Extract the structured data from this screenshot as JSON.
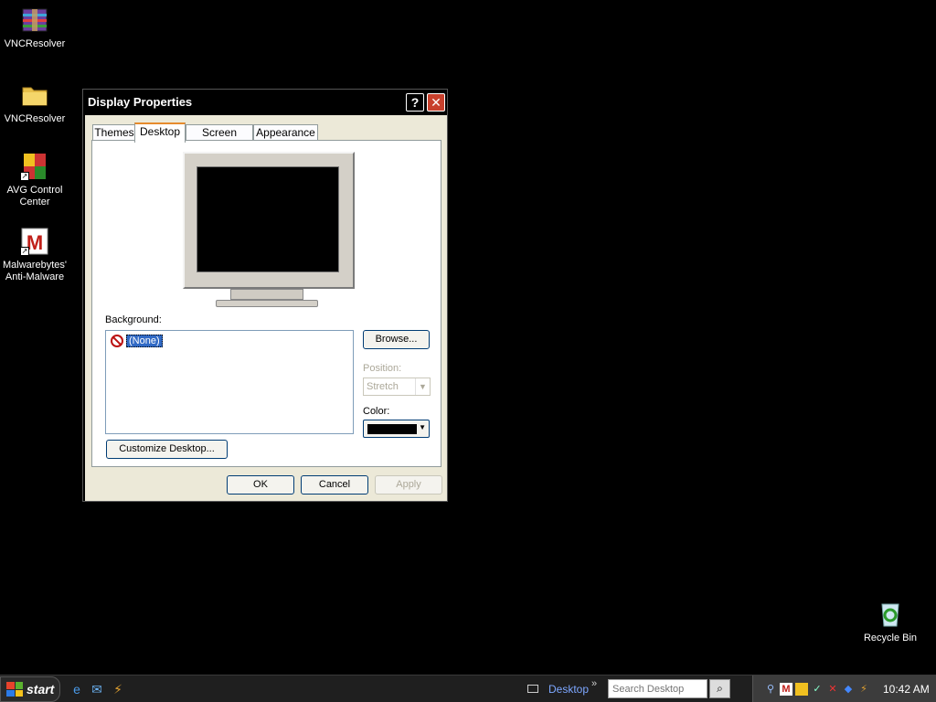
{
  "desktop": {
    "icons": [
      {
        "label": "VNCResolver",
        "icon": "winrar-archive-icon"
      },
      {
        "label": "VNCResolver",
        "icon": "folder-icon"
      },
      {
        "label": "AVG Control Center",
        "icon": "avg-icon"
      },
      {
        "label": "Malwarebytes' Anti-Malware",
        "icon": "malwarebytes-icon"
      },
      {
        "label": "Recycle Bin",
        "icon": "recycle-bin-icon"
      }
    ]
  },
  "dialog": {
    "title": "Display Properties",
    "help": "?",
    "close": "✕",
    "tabs": [
      {
        "label": "Themes",
        "active": false
      },
      {
        "label": "Desktop",
        "active": true
      },
      {
        "label": "Screen Saver",
        "active": false
      },
      {
        "label": "Appearance",
        "active": false
      }
    ],
    "background_label": "Background:",
    "background_items": [
      {
        "label": "(None)",
        "selected": true
      }
    ],
    "browse": "Browse...",
    "position_label": "Position:",
    "position_value": "Stretch",
    "color_label": "Color:",
    "color_value": "#000000",
    "customize": "Customize Desktop...",
    "ok": "OK",
    "cancel": "Cancel",
    "apply": "Apply"
  },
  "taskbar": {
    "start": "start",
    "toolbar_label": "Desktop",
    "chevron": "»",
    "search_placeholder": "Search Desktop",
    "clock": "10:42 AM",
    "quick_launch": [
      "internet-explorer-icon",
      "outlook-express-icon",
      "winamp-icon"
    ],
    "tray_icons": [
      "search-icon",
      "malwarebytes-icon",
      "avg-icon",
      "network-icon",
      "security-alert-icon",
      "bluetooth-icon",
      "winamp-icon"
    ]
  }
}
